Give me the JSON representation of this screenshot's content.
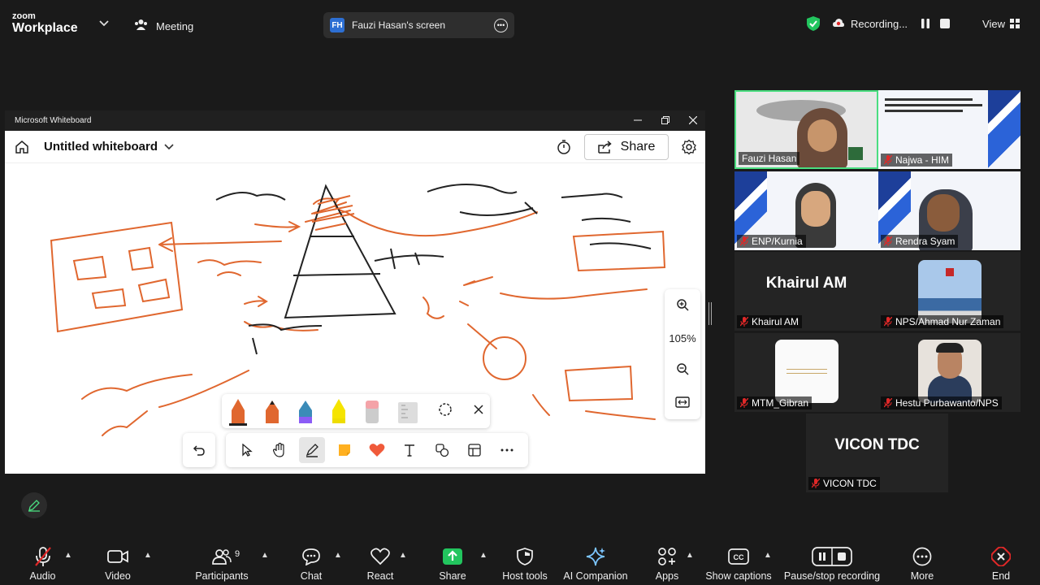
{
  "topbar": {
    "logo_line1": "zoom",
    "logo_line2": "Workplace",
    "meeting_label": "Meeting",
    "screen_initials": "FH",
    "screen_label": "Fauzi Hasan's screen",
    "recording_label": "Recording...",
    "view_label": "View"
  },
  "whiteboard": {
    "app_title": "Microsoft Whiteboard",
    "doc_name": "Untitled whiteboard",
    "share_label": "Share",
    "zoom_level": "105%",
    "ink_color": "#e0672f"
  },
  "participants": [
    {
      "name": "Fauzi Hasan",
      "muted": false
    },
    {
      "name": "Najwa - HIM",
      "muted": true
    },
    {
      "name": "ENP/Kurnia",
      "muted": true
    },
    {
      "name": "Rendra Syam",
      "muted": true
    },
    {
      "name": "Khairul AM",
      "muted": true,
      "display": "Khairul AM"
    },
    {
      "name": "NPS/Ahmad Nur Zaman",
      "muted": true
    },
    {
      "name": "MTM_Gibran",
      "muted": true
    },
    {
      "name": "Hestu Purbawanto/NPS",
      "muted": true
    },
    {
      "name": "VICON TDC",
      "muted": true,
      "display": "VICON TDC"
    }
  ],
  "toolbar": {
    "audio": "Audio",
    "video": "Video",
    "participants": "Participants",
    "participants_count": "9",
    "chat": "Chat",
    "react": "React",
    "share": "Share",
    "host_tools": "Host tools",
    "ai_companion": "AI Companion",
    "apps": "Apps",
    "show_captions": "Show captions",
    "pause_stop": "Pause/stop recording",
    "more": "More",
    "end": "End"
  },
  "colors": {
    "accent_green": "#22c55e",
    "end_red": "#e02828",
    "active_speaker": "#4ade80"
  }
}
